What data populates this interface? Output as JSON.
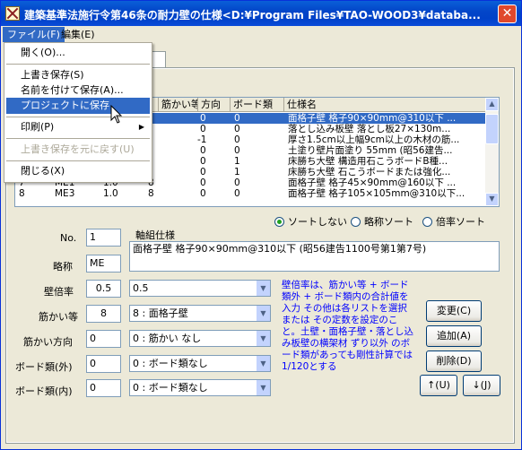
{
  "window": {
    "title": "建築基準法施行令第46条の耐力壁の仕様<D:¥Program Files¥TAO-WOOD3¥databa...",
    "close_symbol": "✕"
  },
  "menubar": {
    "file": "ファイル(F)",
    "edit": "編集(E)"
  },
  "file_menu": {
    "open": "開く(O)...",
    "save": "上書き保存(S)",
    "save_as": "名前を付けて保存(A)...",
    "save_project": "プロジェクトに保存",
    "print": "印刷(P)",
    "revert": "上書き保存を元に戻す(U)",
    "close": "閉じる(X)"
  },
  "grid": {
    "headers": [
      "",
      "",
      "筋かい等",
      "方向",
      "ボード類",
      "仕様名"
    ],
    "rows": [
      {
        "no": "",
        "name": "",
        "mult": "",
        "brace": "",
        "dir": "0",
        "board": "0",
        "spec": "面格子壁  格子90×90mm@310以下 ..."
      },
      {
        "no": "",
        "name": "",
        "mult": "",
        "brace": "",
        "dir": "0",
        "board": "0",
        "spec": "落とし込み板壁  落とし板27×130m..."
      },
      {
        "no": "",
        "name": "",
        "mult": "",
        "brace": "",
        "dir": "-1",
        "board": "0",
        "spec": "厚さ1.5cm以上幅9cm以上の木材の筋..."
      },
      {
        "no": "",
        "name": "",
        "mult": "",
        "brace": "",
        "dir": "0",
        "board": "0",
        "spec": "土塗り壁片面塗り  55mm  (昭56建告..."
      },
      {
        "no": "",
        "name": "",
        "mult": "",
        "brace": "",
        "dir": "0",
        "board": "1",
        "spec": "床勝ち大壁  構造用石こうボードB種..."
      },
      {
        "no": "",
        "name": "",
        "mult": "",
        "brace": "",
        "dir": "0",
        "board": "1",
        "spec": "床勝ち大壁  石こうボードまたは強化..."
      },
      {
        "no": "7",
        "name": "ME1",
        "mult": "1.0",
        "brace": "8",
        "dir": "0",
        "board": "0",
        "spec": "面格子壁  格子45×90mm@160以下 ..."
      },
      {
        "no": "8",
        "name": "ME3",
        "mult": "1.0",
        "brace": "8",
        "dir": "0",
        "board": "0",
        "spec": "面格子壁  格子105×105mm@310以下..."
      }
    ]
  },
  "sort": {
    "none": "ソートしない",
    "by_name": "略称ソート",
    "by_mult": "倍率ソート",
    "selected": "none"
  },
  "form": {
    "no_label": "No.",
    "no_value": "1",
    "spec_label": "軸組仕様",
    "spec_value": "面格子壁  格子90×90mm@310以下 (昭56建告1100号第1第7号)",
    "abbr_label": "略称",
    "abbr_value": "ME",
    "mult_label": "壁倍率",
    "mult_value": "0.5",
    "mult_combo": "0.5",
    "brace_label": "筋かい等",
    "brace_value": "8",
    "brace_combo": "8 : 面格子壁",
    "dir_label": "筋かい方向",
    "dir_value": "0",
    "dir_combo": "0 : 筋かい なし",
    "board_out_label": "ボード類(外)",
    "board_out_value": "0",
    "board_out_combo": "0 : ボード類なし",
    "board_in_label": "ボード類(内)",
    "board_in_value": "0",
    "board_in_combo": "0 : ボード類なし"
  },
  "note": "壁倍率は、筋かい等 + ボード類外 + ボード類内の合計値を入力 その他は各リストを選択または その定数を設定のこと。土壁・面格子壁・落とし込み板壁の横架材 ずり以外 のボード類があっても剛性計算では1/120とする",
  "buttons": {
    "change": "変更(C)",
    "add": "追加(A)",
    "delete": "削除(D)",
    "up": "↑(U)",
    "down": "↓(J)"
  }
}
